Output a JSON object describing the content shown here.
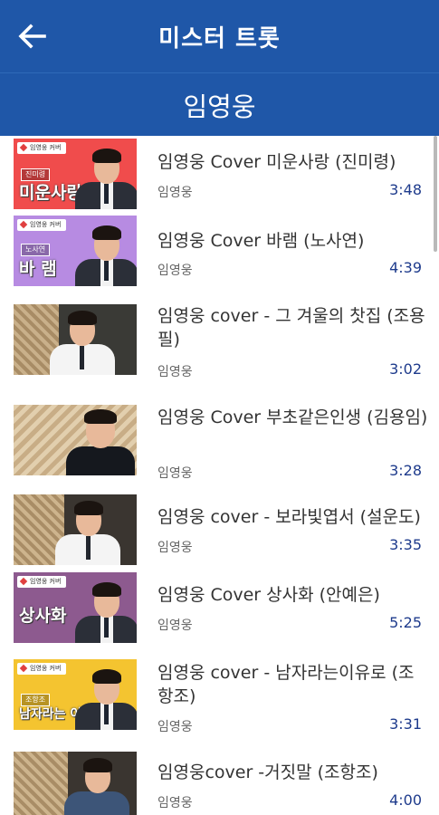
{
  "appbar": {
    "title": "미스터 트롯",
    "back_icon": "arrow-left-icon"
  },
  "section": {
    "title": "임영웅"
  },
  "colors": {
    "primary": "#1f57a8",
    "duration": "#1e3b8c"
  },
  "items": [
    {
      "title": "임영웅 Cover 미운사랑 (진미령)",
      "channel": "임영웅",
      "duration": "3:48",
      "thumb": {
        "badge": "임영웅 커버",
        "small_label": "진미령",
        "big_label": "미운사랑"
      }
    },
    {
      "title": "임영웅 Cover 바램 (노사연)",
      "channel": "임영웅",
      "duration": "4:39",
      "thumb": {
        "badge": "임영웅 커버",
        "small_label": "노사연",
        "big_label": "바 램"
      }
    },
    {
      "title": "임영웅 cover - 그 겨울의 찻집 (조용필)",
      "channel": "임영웅",
      "duration": "3:02",
      "thumb": {}
    },
    {
      "title": "임영웅 Cover 부초같은인생 (김용임)",
      "channel": "임영웅",
      "duration": "3:28",
      "thumb": {}
    },
    {
      "title": "임영웅 cover - 보라빛엽서 (설운도)",
      "channel": "임영웅",
      "duration": "3:35",
      "thumb": {}
    },
    {
      "title": "임영웅 Cover 상사화 (안예은)",
      "channel": "임영웅",
      "duration": "5:25",
      "thumb": {
        "badge": "임영웅 커버",
        "big_label": "상사화"
      }
    },
    {
      "title": "임영웅 cover - 남자라는이유로 (조항조)",
      "channel": "임영웅",
      "duration": "3:31",
      "thumb": {
        "badge": "임영웅 커버",
        "small_label": "조항조",
        "big_label": "남자라는 이유로"
      }
    },
    {
      "title": "임영웅cover -거짓말 (조항조)",
      "channel": "임영웅",
      "duration": "4:00",
      "thumb": {}
    }
  ]
}
